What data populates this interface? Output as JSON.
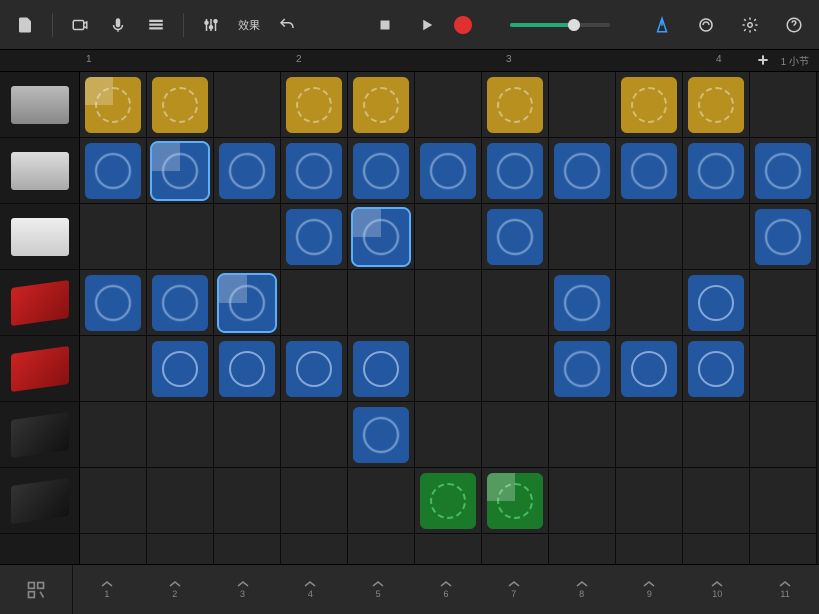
{
  "toolbar": {
    "fx_label": "效果"
  },
  "ruler": {
    "marks": [
      "1",
      "2",
      "3",
      "4"
    ],
    "zoom": "1 小节"
  },
  "tracks": [
    {
      "name": "drums-1",
      "style": "ti-drum1"
    },
    {
      "name": "drums-2",
      "style": "ti-drum2"
    },
    {
      "name": "synth-1",
      "style": "ti-synth"
    },
    {
      "name": "keys-red-1",
      "style": "ti-keys-red"
    },
    {
      "name": "keys-red-2",
      "style": "ti-keys-red"
    },
    {
      "name": "keys-dark-1",
      "style": "ti-keys-dark"
    },
    {
      "name": "keys-dark-2",
      "style": "ti-keys-dark"
    }
  ],
  "cols": 11,
  "rows": 8,
  "cells": [
    {
      "r": 0,
      "c": 0,
      "color": "yellow",
      "playing": true
    },
    {
      "r": 0,
      "c": 1,
      "color": "yellow"
    },
    {
      "r": 0,
      "c": 3,
      "color": "yellow"
    },
    {
      "r": 0,
      "c": 4,
      "color": "yellow"
    },
    {
      "r": 0,
      "c": 6,
      "color": "yellow"
    },
    {
      "r": 0,
      "c": 8,
      "color": "yellow"
    },
    {
      "r": 0,
      "c": 9,
      "color": "yellow"
    },
    {
      "r": 1,
      "c": 0,
      "color": "blue",
      "wavy": true
    },
    {
      "r": 1,
      "c": 1,
      "color": "blue",
      "wavy": true,
      "playing": true,
      "selected": true
    },
    {
      "r": 1,
      "c": 2,
      "color": "blue",
      "wavy": true
    },
    {
      "r": 1,
      "c": 3,
      "color": "blue",
      "wavy": true
    },
    {
      "r": 1,
      "c": 4,
      "color": "blue",
      "wavy": true
    },
    {
      "r": 1,
      "c": 5,
      "color": "blue",
      "wavy": true
    },
    {
      "r": 1,
      "c": 6,
      "color": "blue",
      "wavy": true
    },
    {
      "r": 1,
      "c": 7,
      "color": "blue",
      "wavy": true
    },
    {
      "r": 1,
      "c": 8,
      "color": "blue",
      "wavy": true
    },
    {
      "r": 1,
      "c": 9,
      "color": "blue",
      "wavy": true
    },
    {
      "r": 1,
      "c": 10,
      "color": "blue",
      "wavy": true
    },
    {
      "r": 2,
      "c": 3,
      "color": "blue",
      "wavy": true
    },
    {
      "r": 2,
      "c": 4,
      "color": "blue",
      "wavy": true,
      "playing": true,
      "selected": true
    },
    {
      "r": 2,
      "c": 6,
      "color": "blue",
      "wavy": true
    },
    {
      "r": 2,
      "c": 10,
      "color": "blue",
      "wavy": true
    },
    {
      "r": 3,
      "c": 0,
      "color": "blue",
      "wavy": true
    },
    {
      "r": 3,
      "c": 1,
      "color": "blue",
      "wavy": true
    },
    {
      "r": 3,
      "c": 2,
      "color": "blue",
      "wavy": true,
      "playing": true,
      "selected": true
    },
    {
      "r": 3,
      "c": 7,
      "color": "blue",
      "wavy": true
    },
    {
      "r": 3,
      "c": 9,
      "color": "blue",
      "solid": true
    },
    {
      "r": 4,
      "c": 1,
      "color": "blue",
      "solid": true
    },
    {
      "r": 4,
      "c": 2,
      "color": "blue",
      "solid": true
    },
    {
      "r": 4,
      "c": 3,
      "color": "blue",
      "solid": true
    },
    {
      "r": 4,
      "c": 4,
      "color": "blue",
      "solid": true
    },
    {
      "r": 4,
      "c": 7,
      "color": "blue",
      "wavy": true
    },
    {
      "r": 4,
      "c": 8,
      "color": "blue",
      "solid": true
    },
    {
      "r": 4,
      "c": 9,
      "color": "blue",
      "solid": true
    },
    {
      "r": 5,
      "c": 4,
      "color": "blue",
      "wavy": true
    },
    {
      "r": 6,
      "c": 5,
      "color": "green",
      "green": true
    },
    {
      "r": 6,
      "c": 6,
      "color": "green",
      "green": true,
      "playing": true
    }
  ],
  "footer": {
    "cols": [
      "1",
      "2",
      "3",
      "4",
      "5",
      "6",
      "7",
      "8",
      "9",
      "10",
      "11"
    ]
  }
}
